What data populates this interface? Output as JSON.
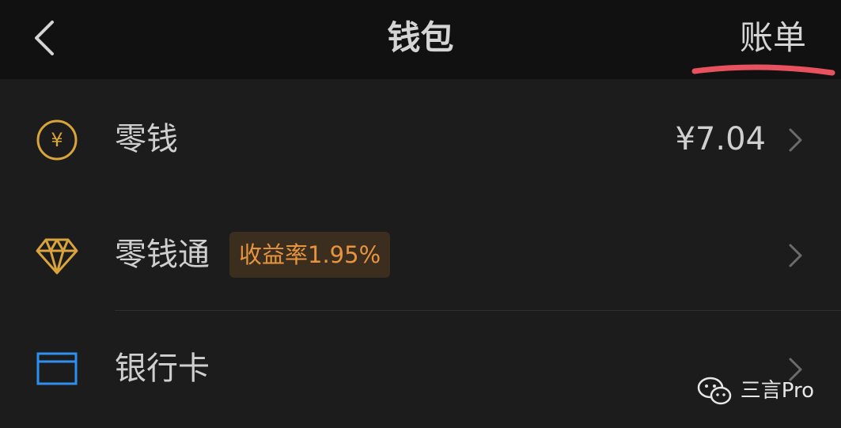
{
  "header": {
    "title": "钱包",
    "right_action": "账单",
    "back_icon": "chevron-left-icon"
  },
  "items": [
    {
      "label": "零钱",
      "value": "¥7.04",
      "icon": "yuan-coin-icon"
    },
    {
      "label": "零钱通",
      "badge": "收益率1.95%",
      "icon": "diamond-icon"
    },
    {
      "label": "银行卡",
      "icon": "bank-card-icon"
    }
  ],
  "watermark": {
    "text": "三言Pro"
  },
  "colors": {
    "background": "#1c1c1c",
    "navbar": "#111111",
    "icon_gold": "#d9a43a",
    "icon_blue": "#2f8ff0",
    "badge_text": "#e8943d",
    "badge_bg": "#3b2e1f",
    "annotation_red": "#e8525f"
  }
}
